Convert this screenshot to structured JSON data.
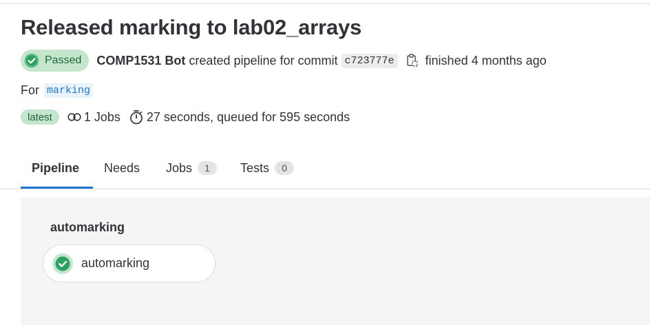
{
  "pipeline": {
    "title": "Released marking to lab02_arrays",
    "status": "Passed",
    "author": "COMP1531 Bot",
    "created_text": "created pipeline for commit",
    "commit_sha": "c723777e",
    "finished_text": "finished 4 months ago",
    "for_label": "For",
    "ref": "marking",
    "latest_badge": "latest",
    "jobs_count_text": "1 Jobs",
    "duration_text": "27 seconds, queued for 595 seconds"
  },
  "tabs": [
    {
      "label": "Pipeline",
      "active": true
    },
    {
      "label": "Needs"
    },
    {
      "label": "Jobs",
      "count": "1"
    },
    {
      "label": "Tests",
      "count": "0"
    }
  ],
  "graph": {
    "stage": "automarking",
    "jobs": [
      {
        "name": "automarking",
        "status": "success"
      }
    ]
  },
  "icons": {
    "status": "check-circle-icon",
    "copy": "clipboard-copy-icon",
    "jobs": "jobs-link-icon",
    "timer": "stopwatch-icon"
  },
  "colors": {
    "success_bg": "#c3e6cd",
    "success_fg": "#24663b",
    "success_icon": "#2da160",
    "link": "#1f75cb",
    "tab_active_underline": "#1f75cb"
  }
}
